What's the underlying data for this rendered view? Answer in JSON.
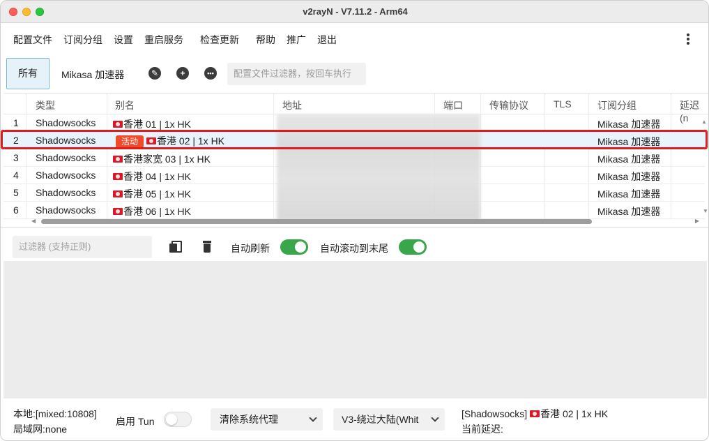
{
  "window": {
    "title": "v2rayN - V7.11.2 - Arm64"
  },
  "menu": [
    "配置文件",
    "订阅分组",
    "设置",
    "重启服务",
    "检查更新",
    "帮助",
    "推广",
    "退出"
  ],
  "toolbar": {
    "tab_all": "所有",
    "tab_group": "Mikasa 加速器",
    "filter_placeholder": "配置文件过滤器，按回车执行"
  },
  "table": {
    "headers": [
      "类型",
      "别名",
      "地址",
      "端口",
      "传输协议",
      "TLS",
      "订阅分组",
      "延迟 (n"
    ],
    "active_badge": "活动",
    "rows": [
      {
        "num": "1",
        "type": "Shadowsocks",
        "alias": "香港 01 | 1x HK",
        "group": "Mikasa 加速器"
      },
      {
        "num": "2",
        "type": "Shadowsocks",
        "alias": "香港 02 | 1x HK",
        "group": "Mikasa 加速器"
      },
      {
        "num": "3",
        "type": "Shadowsocks",
        "alias": "香港家宽 03 | 1x HK",
        "group": "Mikasa 加速器"
      },
      {
        "num": "4",
        "type": "Shadowsocks",
        "alias": "香港 04 | 1x HK",
        "group": "Mikasa 加速器"
      },
      {
        "num": "5",
        "type": "Shadowsocks",
        "alias": "香港 05 | 1x HK",
        "group": "Mikasa 加速器"
      },
      {
        "num": "6",
        "type": "Shadowsocks",
        "alias": "香港 06 | 1x HK",
        "group": "Mikasa 加速器"
      }
    ]
  },
  "log": {
    "filter_placeholder": "过滤器 (支持正则)",
    "auto_refresh_label": "自动刷新",
    "auto_refresh_on": true,
    "auto_scroll_label": "自动滚动到末尾",
    "auto_scroll_on": true
  },
  "status": {
    "local": "本地:[mixed:10808]",
    "lan": "局域网:none",
    "tun_label": "启用 Tun",
    "tun_on": false,
    "proxy_select": "清除系统代理",
    "routing_select": "V3-绕过大陆(Whit",
    "current_server": "[Shadowsocks] ",
    "current_alias": "香港 02 | 1x HK",
    "current_delay_label": "当前延迟:"
  },
  "colors": {
    "accent": "#3aa64a",
    "badge": "#f04a2a",
    "highlight": "#e11b1b",
    "selected_row": "#e9f3fb"
  }
}
